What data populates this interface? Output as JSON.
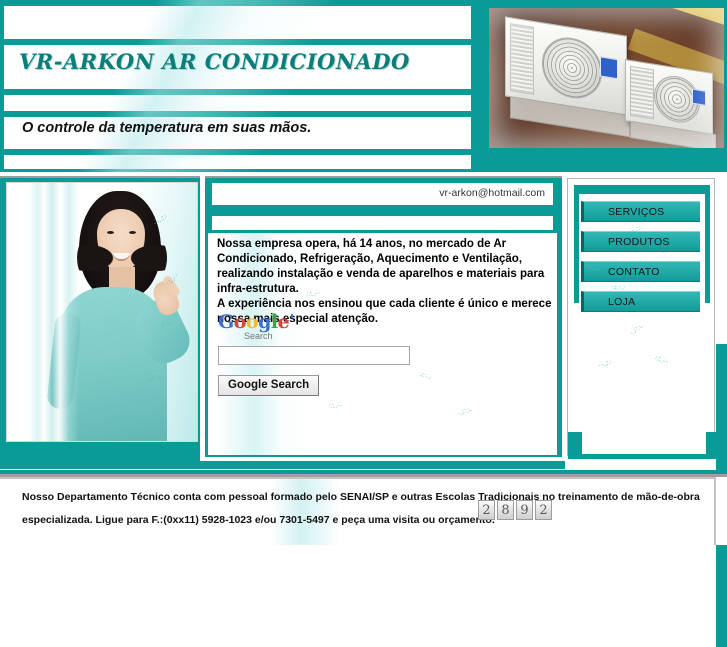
{
  "site": {
    "title": "VR-ARKON AR CONDICIONADO",
    "tagline": "O controle da temperatura em suas mãos.",
    "email": "vr-arkon@hotmail.com"
  },
  "banner": {
    "photo_alt": "air-conditioner-outdoor-units-photo"
  },
  "left_photo": {
    "alt": "smiling-woman-pointing-photo"
  },
  "main": {
    "paragraph_1": "Nossa empresa opera, há 14 anos, no mercado de Ar Condicionado, Refrigeração, Aquecimento e Ventilação, realizando instalação e venda de aparelhos e materiais para infra-estrutura.",
    "paragraph_2": "A experiência nos ensinou que cada cliente é único e merece nossa mais especial atenção."
  },
  "google_search": {
    "logo": {
      "g1": "G",
      "o1": "o",
      "o2": "o",
      "g2": "g",
      "l": "l",
      "e": "e",
      "tm": "ˈ"
    },
    "subtitle": "Search",
    "input_value": "",
    "input_placeholder": "",
    "button_label": "Google Search"
  },
  "nav": {
    "items": [
      {
        "label": "SERVIÇOS"
      },
      {
        "label": "PRODUTOS"
      },
      {
        "label": "CONTATO"
      },
      {
        "label": "LOJA"
      }
    ]
  },
  "footer": {
    "line_1": "Nosso Departamento Técnico conta com pessoal formado pelo SENAI/SP e outras Escolas Tradicionais no treinamento de mão-de-obra",
    "line_2": "especializada. Ligue para F.:(0xx11) 5928-1023 e/ou 7301-5497 e peça uma visita ou orçamento.",
    "visitor_counter": [
      "2",
      "8",
      "9",
      "2"
    ]
  },
  "colors": {
    "teal": "#0a9b96",
    "teal_light": "#33b7b5",
    "teal_dark": "#046663",
    "title_text": "#0d7d7a"
  },
  "sparkles": {
    "a": "∙·˙·∙‥∶∵·",
    "b": "·∵∶‥∙·˙∙·",
    "c": "˙·∙∶∵·‥∙",
    "d": "∙‥∶·˙∵·∙·"
  }
}
